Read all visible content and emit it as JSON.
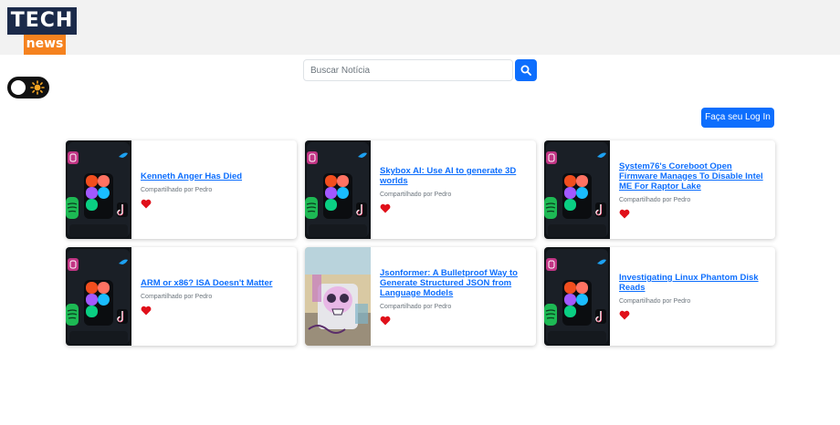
{
  "header": {
    "logo_top": "TECH",
    "logo_bottom": "news"
  },
  "search": {
    "placeholder": "Buscar Notícia",
    "button_icon": "search-icon"
  },
  "theme_toggle": {
    "icon": "sun-icon",
    "knob_color": "#ffffff",
    "sun_color": "#f5a623"
  },
  "login": {
    "label": "Faça seu Log In"
  },
  "colors": {
    "primary": "#0d6efd",
    "heart": "#e0101a",
    "brand_navy": "#1b2a4a",
    "brand_orange": "#f5821f"
  },
  "articles": [
    {
      "title": "Kenneth Anger Has Died",
      "meta": "Compartilhado por Pedro",
      "thumb": "social-apps"
    },
    {
      "title": "Skybox AI: Use AI to generate 3D worlds",
      "meta": "Compartilhado por Pedro",
      "thumb": "social-apps"
    },
    {
      "title": "System76's Coreboot Open Firmware Manages To Disable Intel ME For Raptor Lake",
      "meta": "Compartilhado por Pedro",
      "thumb": "social-apps"
    },
    {
      "title": "ARM or x86? ISA Doesn't Matter",
      "meta": "Compartilhado por Pedro",
      "thumb": "social-apps"
    },
    {
      "title": "Jsonformer: A Bulletproof Way to Generate Structured JSON from Language Models",
      "meta": "Compartilhado por Pedro",
      "thumb": "graffiti-skull"
    },
    {
      "title": "Investigating Linux Phantom Disk Reads",
      "meta": "Compartilhado por Pedro",
      "thumb": "social-apps"
    }
  ]
}
